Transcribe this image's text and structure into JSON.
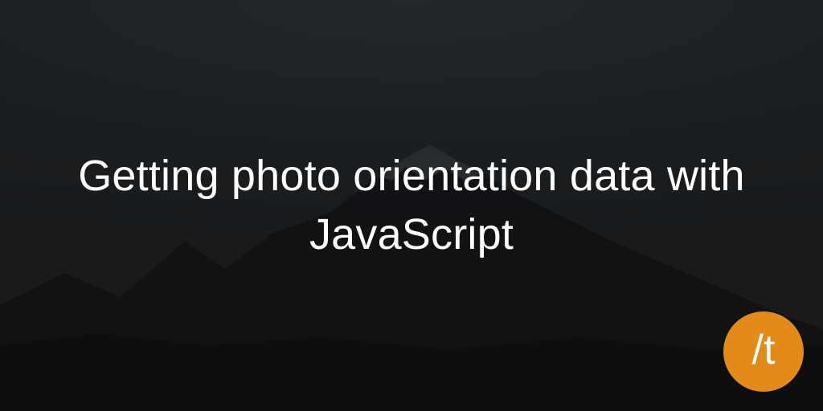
{
  "hero": {
    "title": "Getting photo orientation data with JavaScript"
  },
  "logo": {
    "text": "/t",
    "bg_color": "#e28b1a",
    "fg_color": "#ffffff"
  }
}
